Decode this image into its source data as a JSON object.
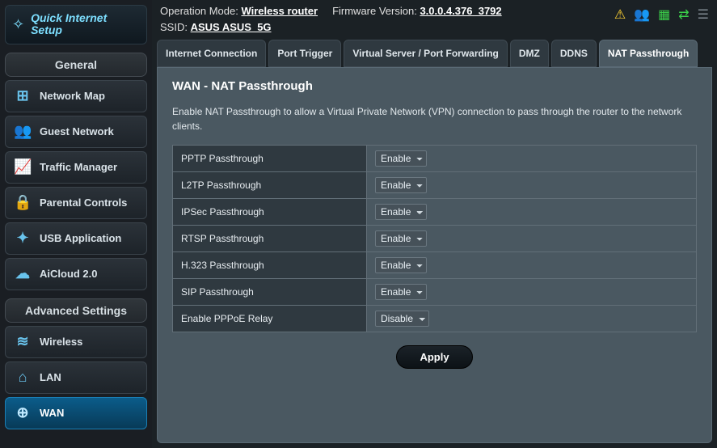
{
  "topbar": {
    "op_mode_label": "Operation Mode:",
    "op_mode_value": "Wireless router",
    "fw_label": "Firmware Version:",
    "fw_value": "3.0.0.4.376_3792",
    "ssid_label": "SSID:",
    "ssid_value": "ASUS  ASUS_5G"
  },
  "sidebar": {
    "qis_label": "Quick Internet Setup",
    "general_header": "General",
    "general_items": [
      {
        "label": "Network Map",
        "icon": "⊞"
      },
      {
        "label": "Guest Network",
        "icon": "👥"
      },
      {
        "label": "Traffic Manager",
        "icon": "📈"
      },
      {
        "label": "Parental Controls",
        "icon": "🔒"
      },
      {
        "label": "USB Application",
        "icon": "✦"
      },
      {
        "label": "AiCloud 2.0",
        "icon": "☁"
      }
    ],
    "advanced_header": "Advanced Settings",
    "advanced_items": [
      {
        "label": "Wireless",
        "icon": "≋"
      },
      {
        "label": "LAN",
        "icon": "⌂"
      },
      {
        "label": "WAN",
        "icon": "⊕",
        "active": true
      }
    ]
  },
  "tabs": [
    "Internet Connection",
    "Port Trigger",
    "Virtual Server / Port Forwarding",
    "DMZ",
    "DDNS",
    "NAT Passthrough"
  ],
  "panel": {
    "title": "WAN - NAT Passthrough",
    "description": "Enable NAT Passthrough to allow a Virtual Private Network (VPN) connection to pass through the router to the network clients.",
    "rows": [
      {
        "label": "PPTP Passthrough",
        "value": "Enable"
      },
      {
        "label": "L2TP Passthrough",
        "value": "Enable"
      },
      {
        "label": "IPSec Passthrough",
        "value": "Enable"
      },
      {
        "label": "RTSP Passthrough",
        "value": "Enable"
      },
      {
        "label": "H.323 Passthrough",
        "value": "Enable"
      },
      {
        "label": "SIP Passthrough",
        "value": "Enable"
      },
      {
        "label": "Enable PPPoE Relay",
        "value": "Disable"
      }
    ],
    "apply_label": "Apply"
  }
}
